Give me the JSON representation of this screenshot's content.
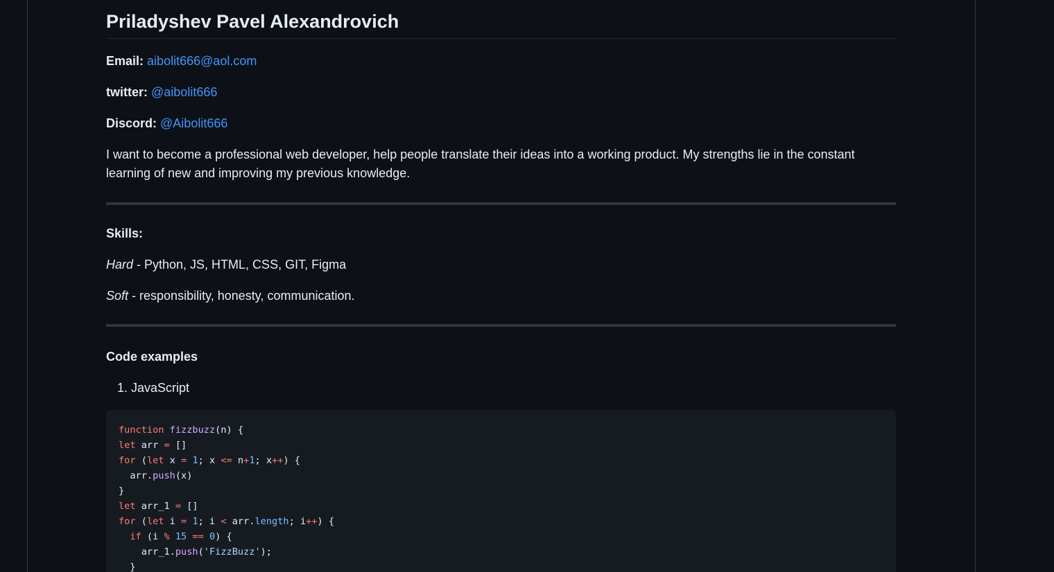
{
  "header": {
    "title": "Priladyshev Pavel Alexandrovich"
  },
  "contacts": {
    "email_label": "Email:",
    "email_value": "aibolit666@aol.com",
    "twitter_label": "twitter:",
    "twitter_value": "@aibolit666",
    "discord_label": "Discord:",
    "discord_value": "@Aibolit666"
  },
  "about": {
    "text": "I want to become a professional web developer, help people translate their ideas into a working product. My strengths lie in the constant learning of new and improving my previous knowledge."
  },
  "skills": {
    "title": "Skills:",
    "hard_label": "Hard",
    "hard_value": " - Python, JS, HTML, CSS, GIT, Figma",
    "soft_label": "Soft",
    "soft_value": " - responsibility, honesty, communication."
  },
  "code_examples": {
    "title": "Code examples",
    "list_items": [
      "JavaScript"
    ]
  },
  "code": {
    "tokens": {
      "function": "function",
      "fizzbuzz": "fizzbuzz",
      "let": "let",
      "for": "for",
      "if": "if",
      "push": "push",
      "length": "length",
      "string": "'FizzBuzz'"
    },
    "lines": [
      "function fizzbuzz(n) {",
      "let arr = []",
      "for (let x = 1; x <= n+1; x++) {",
      "  arr.push(x)",
      "}",
      "let arr_1 = []",
      "for (let i = 1; i < arr.length; i++) {",
      "  if (i % 15 == 0) {",
      "    arr_1.push('FizzBuzz');",
      "  }"
    ]
  },
  "colors": {
    "background": "#0d1117",
    "text": "#e6edf3",
    "link": "#4493f8",
    "code_bg": "#161b22",
    "keyword": "#ff7b72",
    "function_name": "#d2a8ff",
    "number": "#79c0ff",
    "string": "#a5d6ff"
  }
}
